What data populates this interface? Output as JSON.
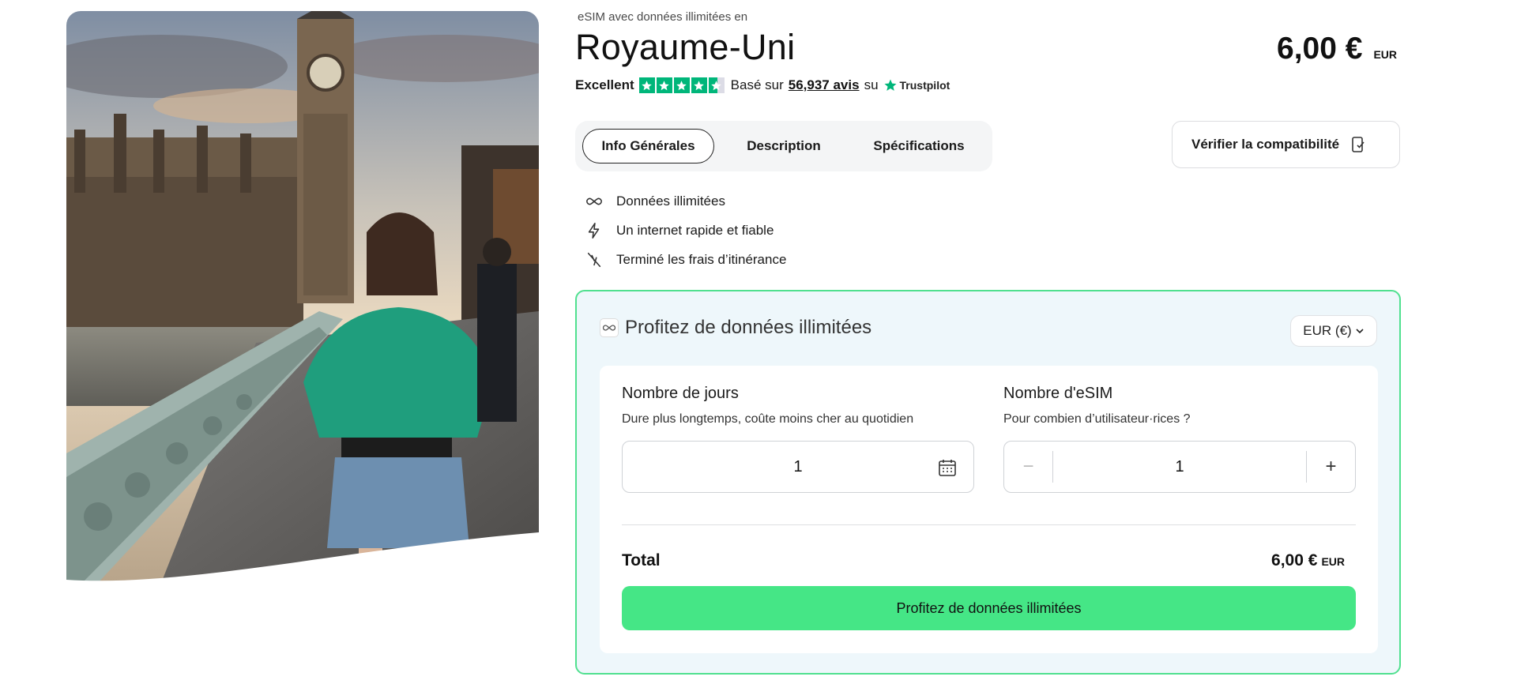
{
  "hero": {
    "alt": "Woman on phone walking on Westminster Bridge with Big Ben in background"
  },
  "product": {
    "eyebrow": "eSIM avec données illimitées en",
    "title": "Royaume-Uni",
    "price": "6,00 €",
    "currency": "EUR"
  },
  "rating": {
    "label": "Excellent",
    "stars": 4.5,
    "based_on": "Basé sur",
    "reviews": "56,937 avis",
    "on": "su",
    "provider": "Trustpilot"
  },
  "tabs": [
    {
      "label": "Info Générales",
      "active": true
    },
    {
      "label": "Description",
      "active": false
    },
    {
      "label": "Spécifications",
      "active": false
    }
  ],
  "compat_button": "Vérifier la compatibilité",
  "features": [
    {
      "icon": "infinity-icon",
      "label": "Données illimitées"
    },
    {
      "icon": "lightning-icon",
      "label": "Un internet rapide et fiable"
    },
    {
      "icon": "no-roaming-icon",
      "label": "Terminé les frais d’itinérance"
    }
  ],
  "panel": {
    "title": "Profitez de données illimitées",
    "currency_select": "EUR (€)",
    "days": {
      "label": "Nombre de jours",
      "sub": "Dure plus longtemps, coûte moins cher au quotidien",
      "value": "1"
    },
    "esims": {
      "label": "Nombre d'eSIM",
      "sub": "Pour combien d’utilisateur·rices ?",
      "value": "1",
      "minus": "−",
      "plus": "+"
    },
    "total_label": "Total",
    "total_value": "6,00 €",
    "total_currency": "EUR",
    "cta": "Profitez de données illimitées"
  },
  "colors": {
    "accent_green": "#45e686",
    "panel_border": "#50e08f",
    "panel_bg": "#eef7fb",
    "trustpilot_green": "#00b67a"
  }
}
